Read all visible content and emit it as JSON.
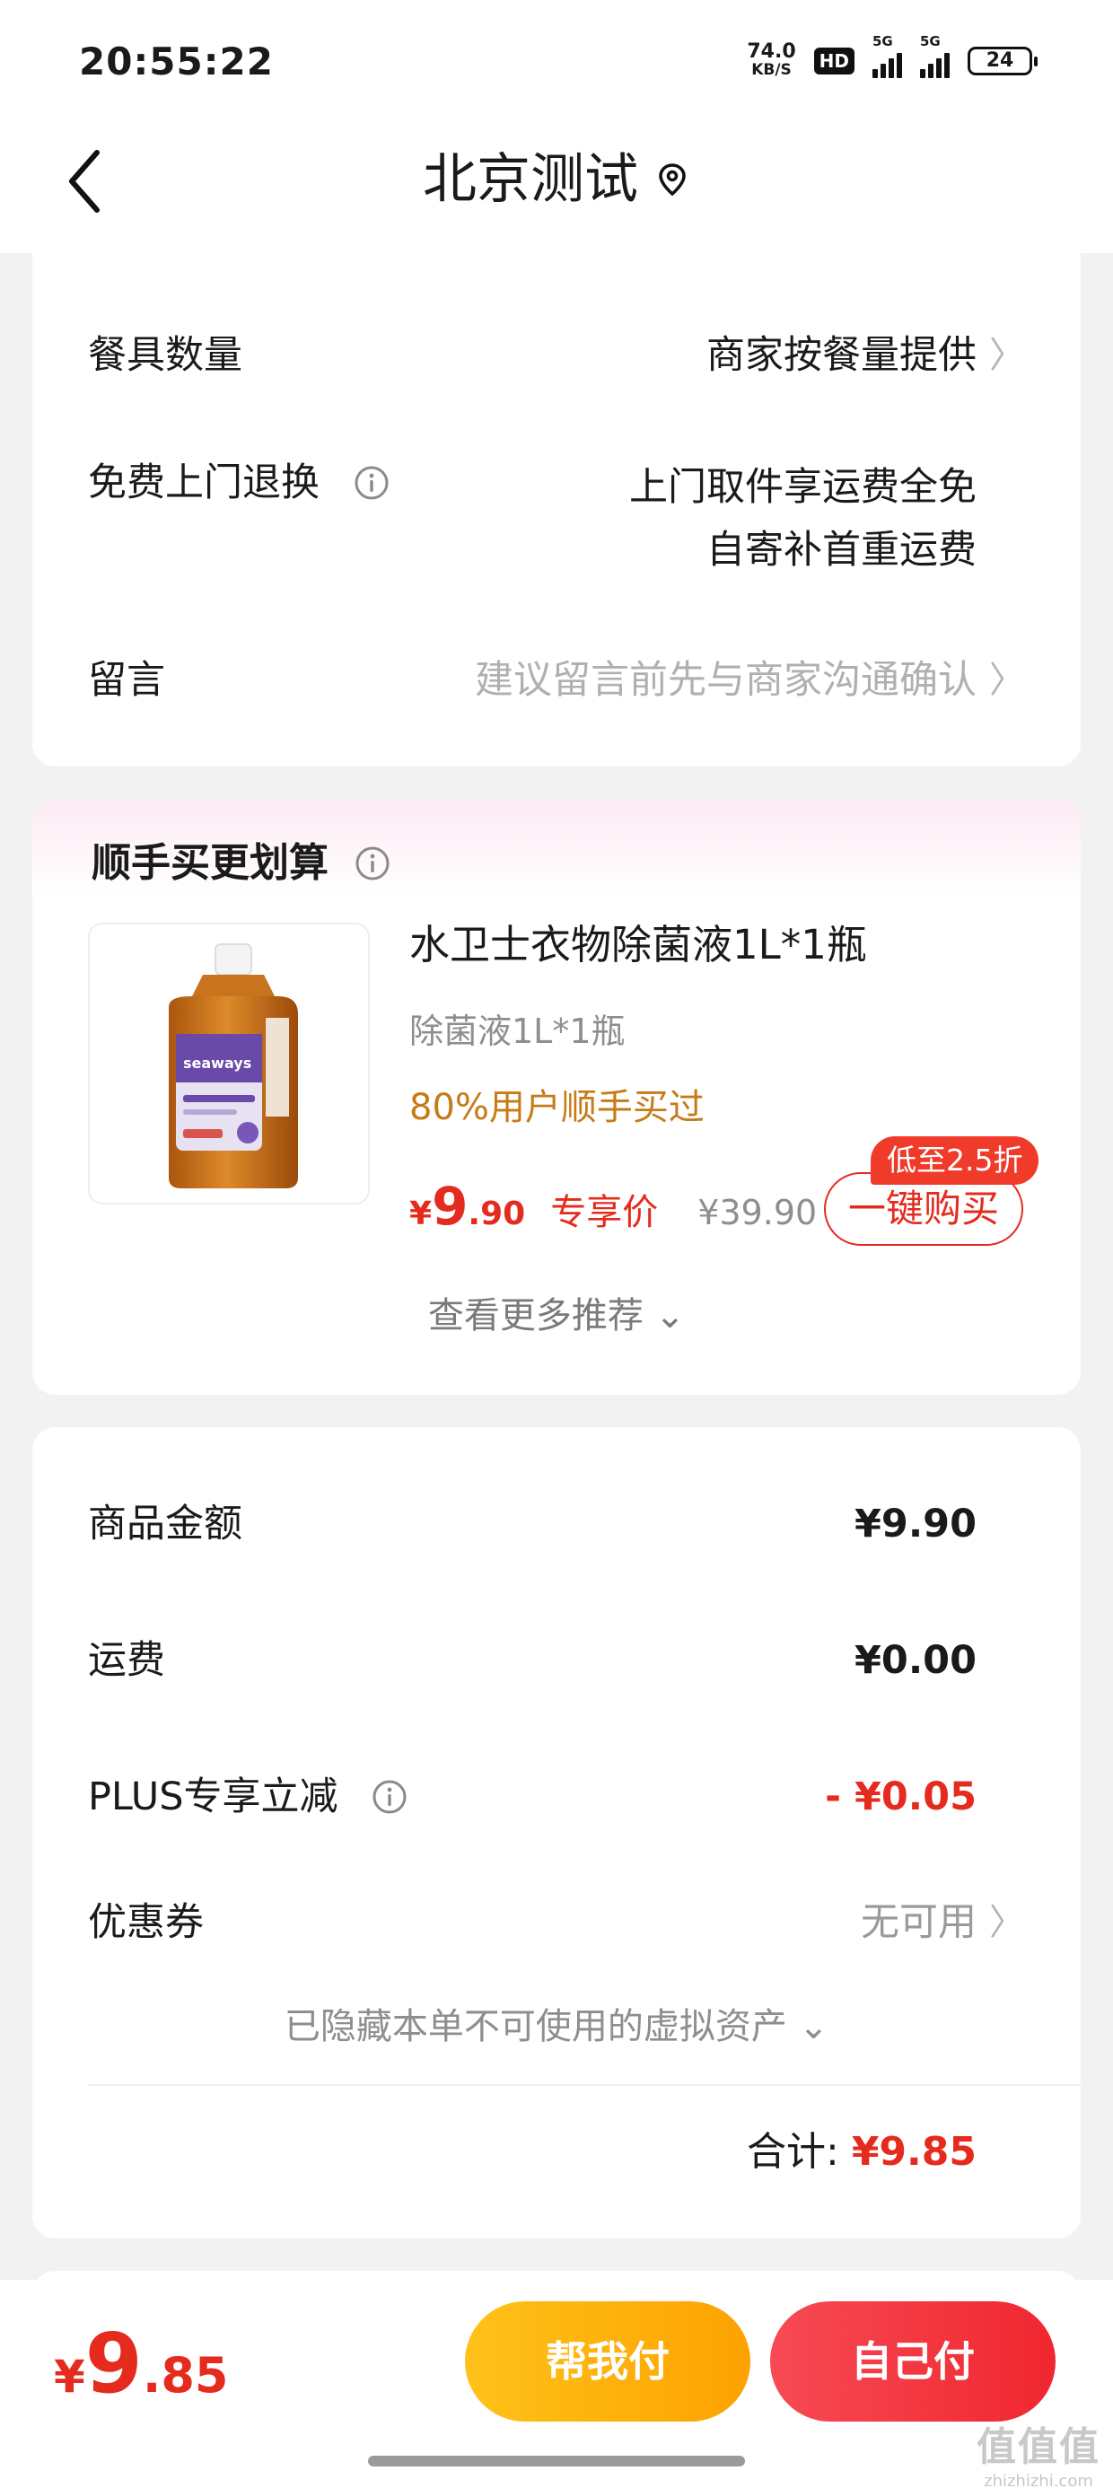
{
  "status_bar": {
    "time": "20:55:22",
    "net_speed_value": "74.0",
    "net_speed_unit": "KB/S",
    "hd_label": "HD",
    "signal1_label": "5G",
    "signal2_label": "5G",
    "battery": "24"
  },
  "nav": {
    "title": "北京测试",
    "back_icon": "chevron-left-icon",
    "location_icon": "map-pin-icon"
  },
  "order_info": {
    "tableware_label": "餐具数量",
    "tableware_value": "商家按餐量提供",
    "return_label": "免费上门退换",
    "return_value_line1": "上门取件享运费全免",
    "return_value_line2": "自寄补首重运费",
    "note_label": "留言",
    "note_placeholder": "建议留言前先与商家沟通确认",
    "chevron": "〉"
  },
  "recommend": {
    "title": "顺手买更划算",
    "product_name": "水卫士衣物除菌液1L*1瓶",
    "product_spec": "除菌液1L*1瓶",
    "social_proof": "80%用户顺手买过",
    "price_symbol": "¥",
    "price_integer": "9",
    "price_decimal": ".90",
    "price_tag": "专享价",
    "original_price": "¥39.90",
    "discount_badge": "低至2.5折",
    "buy_button": "一键购买",
    "more_link": "查看更多推荐 ⌄",
    "image_brand_text": "seaways"
  },
  "summary": {
    "goods_label": "商品金额",
    "goods_amount": "¥9.90",
    "shipping_label": "运费",
    "shipping_amount": "¥0.00",
    "plus_label": "PLUS专享立减",
    "plus_amount": "- ¥0.05",
    "coupon_label": "优惠券",
    "coupon_value": "无可用",
    "hidden_assets": "已隐藏本单不可使用的虚拟资产 ⌄",
    "total_label": "合计:",
    "total_amount": "¥9.85"
  },
  "bottom_bar": {
    "total_symbol": "¥",
    "total_integer": "9",
    "total_decimal": ".85",
    "help_pay_button": "帮我付",
    "self_pay_button": "自己付"
  },
  "watermark": {
    "big": "值值值",
    "small": "zhizhizhi.com"
  },
  "colors": {
    "accent_red": "#e52b1e",
    "social_orange": "#c67b17",
    "help_button_yellow": "#fda200",
    "self_button_red": "#f0262f"
  }
}
